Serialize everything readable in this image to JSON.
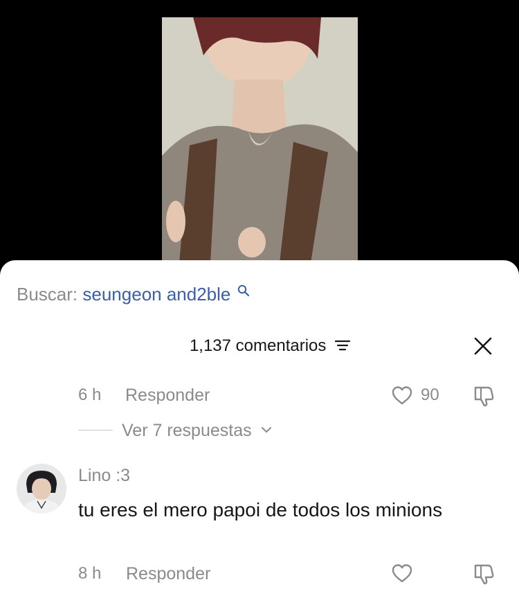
{
  "search": {
    "prefix": "Buscar:",
    "term": "seungeon and2ble"
  },
  "comments_header": {
    "count_label": "1,137 comentarios"
  },
  "icons": {
    "search": "search-icon",
    "sort": "sort-icon",
    "close": "close-icon",
    "like": "heart-icon",
    "dislike": "thumbs-down-icon",
    "expand": "chevron-down-icon"
  },
  "comment_1": {
    "time": "6 h",
    "reply_label": "Responder",
    "likes": "90"
  },
  "replies": {
    "label": "Ver 7 respuestas"
  },
  "comment_2": {
    "username": "Lino :3",
    "text": "tu eres el mero papoi de todos los minions",
    "time": "8 h",
    "reply_label": "Responder"
  },
  "colors": {
    "link": "#3a5ea8",
    "muted": "#8a8a8e",
    "text": "#161616",
    "sheet": "#ffffff"
  }
}
